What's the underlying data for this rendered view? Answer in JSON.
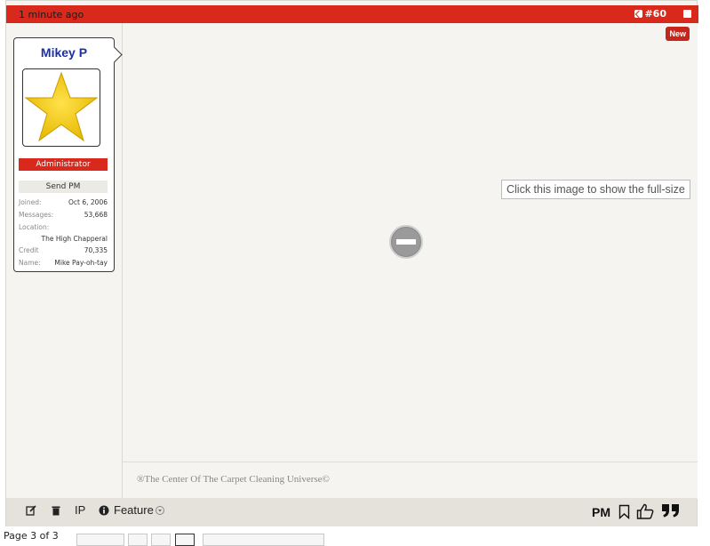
{
  "post": {
    "time": "1 minute ago",
    "share_label": "#60",
    "new_badge": "New"
  },
  "user": {
    "name": "Mikey P",
    "role": "Administrator",
    "send_pm": "Send PM",
    "joined_label": "Joined:",
    "joined_value": "Oct 6, 2006",
    "messages_label": "Messages:",
    "messages_value": "53,668",
    "location_label": "Location:",
    "location_value": "The High Chapperal",
    "credit_label": "Credit",
    "credit_value": "70,335",
    "name_label": "Name:",
    "name_value": "Mike Pay-oh-tay"
  },
  "content": {
    "tooltip": "Click this image to show the full-size"
  },
  "signature": "®The Center Of The Carpet Cleaning Universe©",
  "footer": {
    "ip_label": "IP",
    "feature_label": "Feature",
    "pm_label": "PM"
  },
  "pager": {
    "label": "Page 3 of 3"
  },
  "colors": {
    "accent": "#d9291c",
    "username": "#1d2fa8"
  }
}
